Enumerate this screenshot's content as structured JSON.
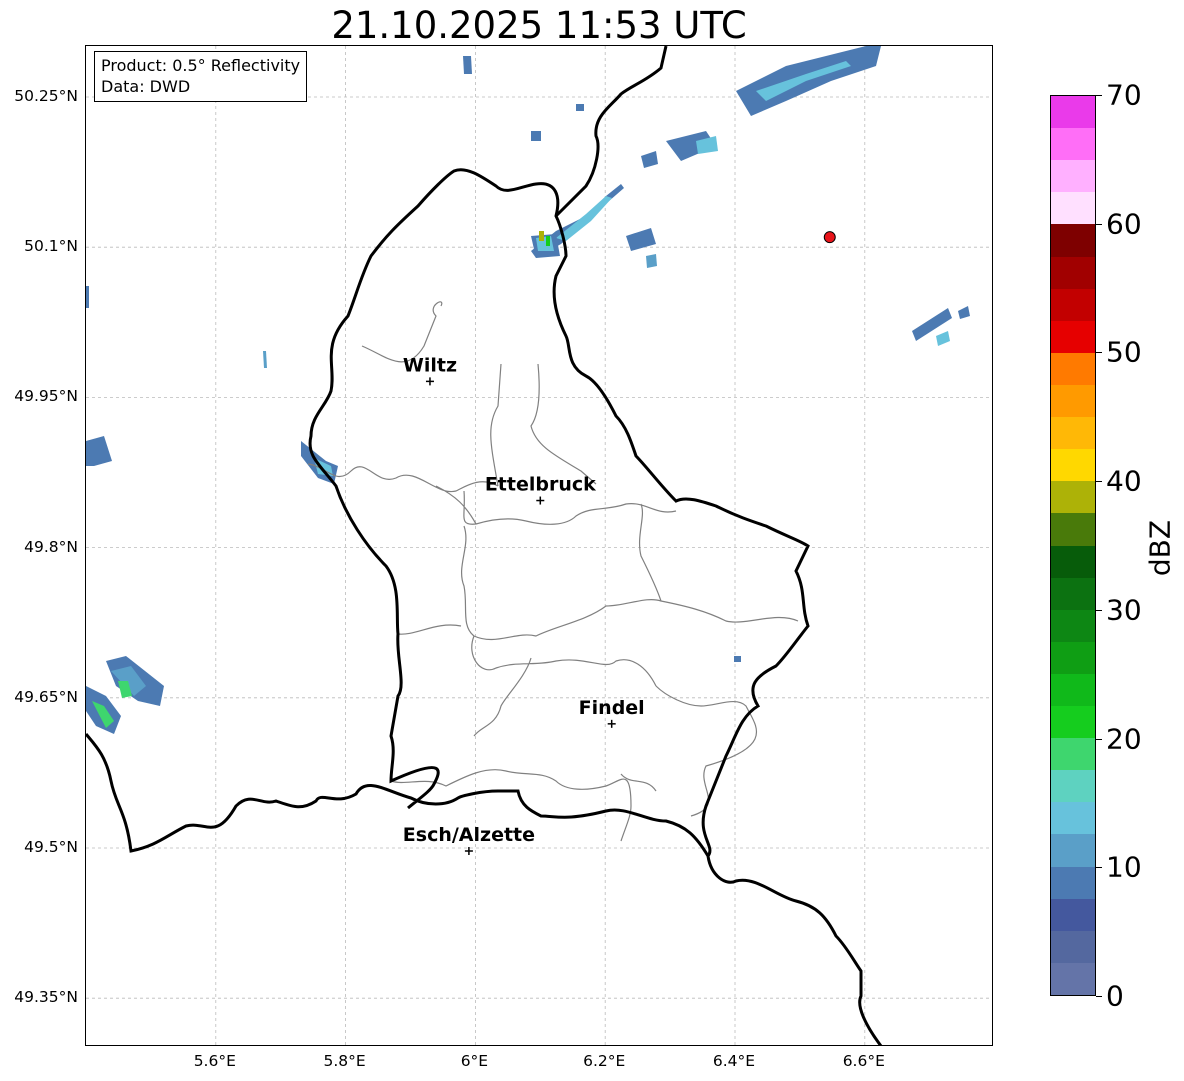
{
  "title": "21.10.2025 11:53 UTC",
  "info": {
    "product": "Product: 0.5° Reflectivity",
    "source": "Data: DWD"
  },
  "map_data": {
    "lon_range": [
      5.4,
      6.8
    ],
    "lat_range": [
      49.3,
      50.3
    ],
    "lat_ticks": [
      {
        "value": 50.25,
        "label": "50.25°N"
      },
      {
        "value": 50.1,
        "label": "50.1°N"
      },
      {
        "value": 49.95,
        "label": "49.95°N"
      },
      {
        "value": 49.8,
        "label": "49.8°N"
      },
      {
        "value": 49.65,
        "label": "49.65°N"
      },
      {
        "value": 49.5,
        "label": "49.5°N"
      },
      {
        "value": 49.35,
        "label": "49.35°N"
      }
    ],
    "lon_ticks": [
      {
        "value": 5.6,
        "label": "5.6°E"
      },
      {
        "value": 5.8,
        "label": "5.8°E"
      },
      {
        "value": 6.0,
        "label": "6°E"
      },
      {
        "value": 6.2,
        "label": "6.2°E"
      },
      {
        "value": 6.4,
        "label": "6.4°E"
      },
      {
        "value": 6.6,
        "label": "6.6°E"
      }
    ],
    "cities": [
      {
        "name": "Wiltz",
        "lon": 5.93,
        "lat": 49.966
      },
      {
        "name": "Ettelbruck",
        "lon": 6.1,
        "lat": 49.847
      },
      {
        "name": "Findel",
        "lon": 6.21,
        "lat": 49.624
      },
      {
        "name": "Esch/Alzette",
        "lon": 5.99,
        "lat": 49.497
      }
    ],
    "radar_marker": {
      "lon": 6.546,
      "lat": 50.11,
      "color": "#e8141a"
    },
    "grid": true
  },
  "colorbar": {
    "label": "dBZ",
    "min": 0,
    "max": 70,
    "tick_labels": [
      {
        "value": 0,
        "label": "0"
      },
      {
        "value": 10,
        "label": "10"
      },
      {
        "value": 20,
        "label": "20"
      },
      {
        "value": 30,
        "label": "30"
      },
      {
        "value": 40,
        "label": "40"
      },
      {
        "value": 50,
        "label": "50"
      },
      {
        "value": 60,
        "label": "60"
      },
      {
        "value": 70,
        "label": "70"
      }
    ],
    "colors": [
      "#6474a8",
      "#54689f",
      "#44589e",
      "#4c7ab2",
      "#5a9fc8",
      "#67c2dc",
      "#5ed2c0",
      "#3ed66e",
      "#15cd1e",
      "#10b91a",
      "#0f9e14",
      "#0d8714",
      "#0c7211",
      "#075c0a",
      "#497a0a",
      "#adb207",
      "#ffd800",
      "#ffb806",
      "#ff9a00",
      "#ff7a00",
      "#e60000",
      "#c20000",
      "#a10000",
      "#7e0000",
      "#ffe0ff",
      "#ffb0ff",
      "#ff6ef7",
      "#ea3aea"
    ]
  }
}
